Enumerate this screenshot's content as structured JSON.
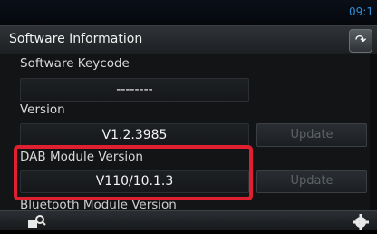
{
  "status": {
    "clock": "09:1"
  },
  "header": {
    "title": "Software Information",
    "back_icon": "back-arrow-icon"
  },
  "sections": [
    {
      "label": "Software Keycode",
      "value": "--------"
    },
    {
      "label": "Version",
      "value": "V1.2.3985",
      "button": "Update"
    },
    {
      "label": "DAB Module Version",
      "value": "V110/10.1.3",
      "button": "Update"
    }
  ],
  "partial_label": "Bluetooth Module Version",
  "footer": {
    "left_icon": "search-device-icon",
    "right_icon": "gear-icon"
  },
  "colors": {
    "highlight": "#e02030",
    "clock": "#2f8fd8"
  }
}
